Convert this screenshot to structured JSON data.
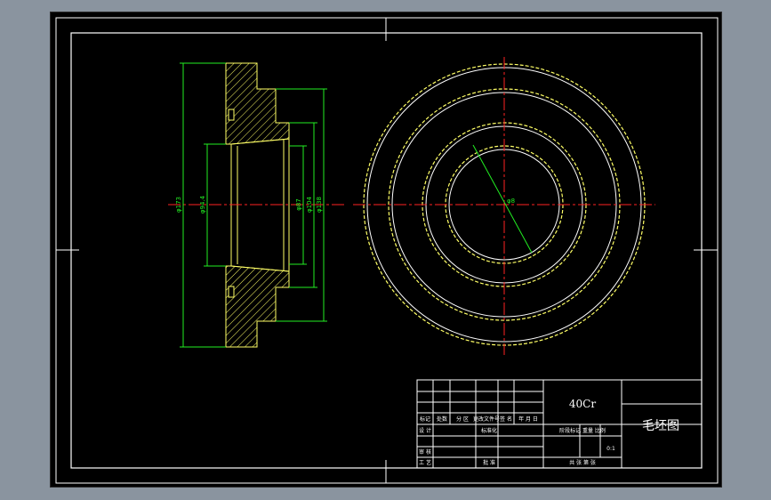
{
  "drawing": {
    "material": "40Cr",
    "title": "毛坯图",
    "scale": "0:1",
    "section_dims": {
      "outer_dia": "φ173",
      "bore_dia": "φ94.4",
      "hub_dia": "φ87",
      "mid_dia": "φ104",
      "step_dia": "φ138"
    },
    "front_dim": "φ8"
  },
  "title_block": {
    "row_labels": [
      "标记",
      "处数",
      "分 区",
      "更改文件号",
      "签 名",
      "年 月 日"
    ],
    "design_label": "设 计",
    "standardize_label": "标准化",
    "stage_labels": "阶段标记 重量 比例",
    "review_label": "审 核",
    "process_label": "工 艺",
    "approve_label": "批 准",
    "sheets_label": "共  张  第  张"
  },
  "colors": {
    "background": "#000000",
    "frame": "#ffffff",
    "outline": "#ffff66",
    "centerline": "#ff2222",
    "dimension": "#22ee22",
    "hatch": "#ffff66"
  }
}
